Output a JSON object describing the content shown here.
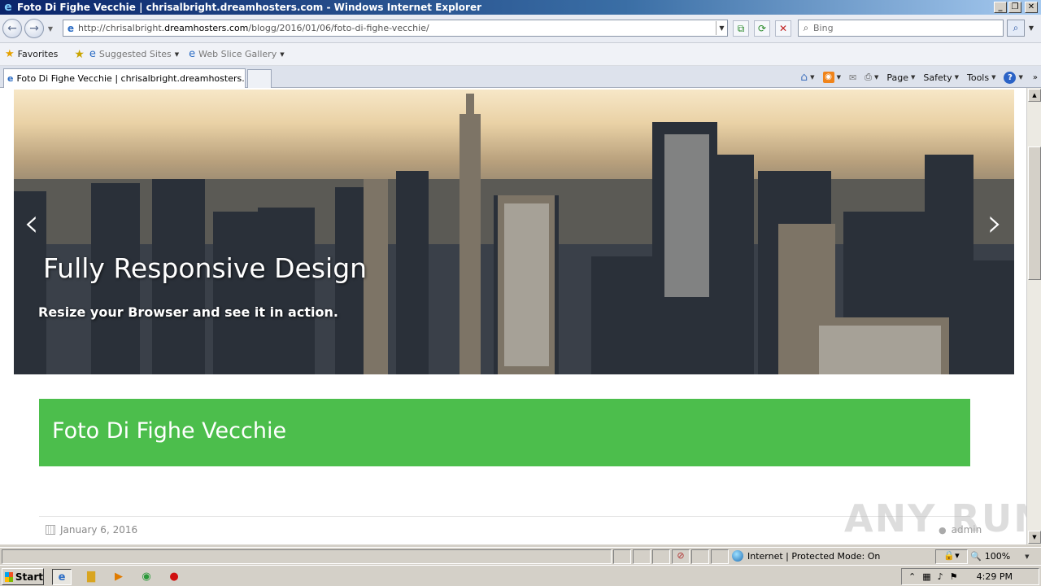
{
  "window": {
    "title": "Foto Di Fighe Vecchie | chrisalbright.dreamhosters.com - Windows Internet Explorer",
    "minimize": "_",
    "restore": "❐",
    "close": "✕"
  },
  "address": {
    "url_prefix": "http://chrisalbright.",
    "url_domain": "dreamhosters.com",
    "url_path": "/blogg/2016/01/06/foto-di-fighe-vecchie/"
  },
  "search": {
    "placeholder": "Bing"
  },
  "favorites_bar": {
    "favorites_label": "Favorites",
    "suggested_sites": "Suggested Sites",
    "web_slice_gallery": "Web Slice Gallery"
  },
  "tabs": [
    {
      "label": "Foto Di Fighe Vecchie | chrisalbright.dreamhosters.com"
    }
  ],
  "command_bar": {
    "page": "Page",
    "safety": "Safety",
    "tools": "Tools",
    "help": "?"
  },
  "slider": {
    "title": "Fully Responsive Design",
    "subtitle": "Resize your Browser and see it in action.",
    "prev": "‹",
    "next": "›"
  },
  "post": {
    "title": "Foto Di Fighe Vecchie",
    "date": "January 6, 2016",
    "author": "admin"
  },
  "watermark": "ANY RUN",
  "status": {
    "zone": "Internet | Protected Mode: On",
    "zoom": "100%"
  },
  "taskbar": {
    "start": "Start",
    "time": "4:29 PM"
  },
  "colors": {
    "post_header": "#4cbe4c",
    "title_bar": "#0a246a"
  }
}
